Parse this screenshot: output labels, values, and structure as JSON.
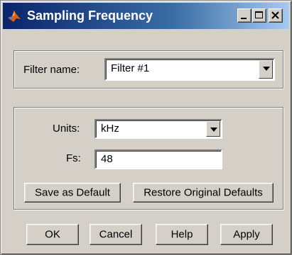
{
  "window": {
    "title": "Sampling Frequency",
    "icon": "matlab-logo-icon"
  },
  "caption_buttons": {
    "minimize": "minimize-icon",
    "maximize": "maximize-icon",
    "close": "close-icon"
  },
  "filter": {
    "label": "Filter name:",
    "selected": "Filter #1"
  },
  "sampling": {
    "units_label": "Units:",
    "units_selected": "kHz",
    "fs_label": "Fs:",
    "fs_value": "48",
    "save_default_label": "Save as Default",
    "restore_defaults_label": "Restore Original Defaults"
  },
  "buttons": {
    "ok": "OK",
    "cancel": "Cancel",
    "help": "Help",
    "apply": "Apply"
  },
  "colors": {
    "titlebar_start": "#0a246a",
    "titlebar_end": "#a6caf0",
    "face": "#d4d0c8"
  }
}
